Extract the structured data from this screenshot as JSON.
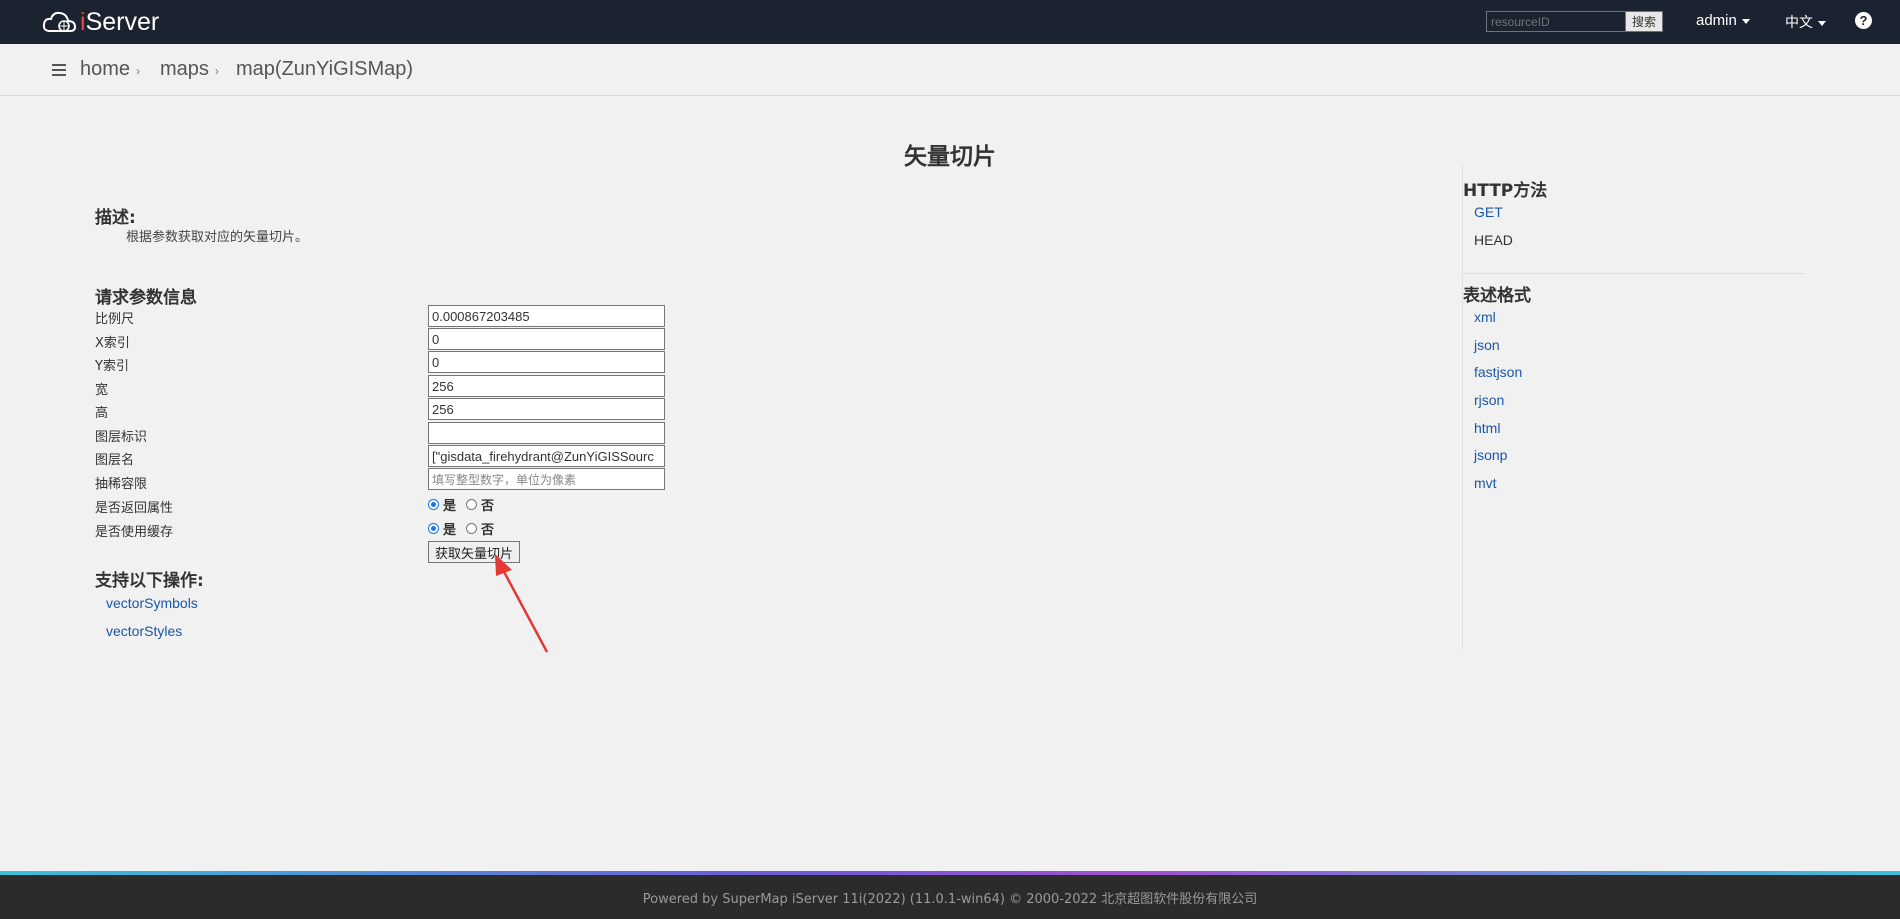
{
  "navbar": {
    "logo_text_i": "i",
    "logo_text_rest": "Server",
    "search_placeholder": "resourceID",
    "search_button": "搜索",
    "user": "admin",
    "language": "中文",
    "help": "?"
  },
  "breadcrumb": [
    {
      "label": "home",
      "sep": "›"
    },
    {
      "label": "maps",
      "sep": "›"
    },
    {
      "label": "map(ZunYiGISMap)",
      "sep": ""
    }
  ],
  "page_title": "矢量切片",
  "description": {
    "heading": "描述:",
    "text": "根据参数获取对应的矢量切片。"
  },
  "params": {
    "heading": "请求参数信息",
    "items": [
      {
        "label": "比例尺",
        "value": "0.000867203485",
        "placeholder": ""
      },
      {
        "label": "X索引",
        "value": "0",
        "placeholder": ""
      },
      {
        "label": "Y索引",
        "value": "0",
        "placeholder": ""
      },
      {
        "label": "宽",
        "value": "256",
        "placeholder": ""
      },
      {
        "label": "高",
        "value": "256",
        "placeholder": ""
      },
      {
        "label": "图层标识",
        "value": "",
        "placeholder": ""
      },
      {
        "label": "图层名",
        "value": "[\"gisdata_firehydrant@ZunYiGISSourc",
        "placeholder": ""
      },
      {
        "label": "抽稀容限",
        "value": "",
        "placeholder": "填写整型数字，单位为像素"
      }
    ],
    "return_attributes": {
      "label": "是否返回属性",
      "yes": "是",
      "no": "否",
      "selected": "yes"
    },
    "use_cache": {
      "label": "是否使用缓存",
      "yes": "是",
      "no": "否",
      "selected": "yes"
    },
    "submit": "获取矢量切片"
  },
  "operations": {
    "heading": "支持以下操作:",
    "links": [
      "vectorSymbols",
      "vectorStyles"
    ]
  },
  "sidebar": {
    "http_heading": "HTTP方法",
    "http_methods": [
      {
        "label": "GET",
        "link": true
      },
      {
        "label": "HEAD",
        "link": false
      }
    ],
    "format_heading": "表述格式",
    "formats": [
      "xml",
      "json",
      "fastjson",
      "rjson",
      "html",
      "jsonp",
      "mvt"
    ]
  },
  "footer": {
    "text": "Powered by SuperMap iServer 11i(2022) (11.0.1-win64) © 2000-2022 北京超图软件股份有限公司"
  },
  "colors": {
    "navbar_bg": "#1b2230",
    "link": "#1a56a8",
    "arrow": "#e53935"
  }
}
